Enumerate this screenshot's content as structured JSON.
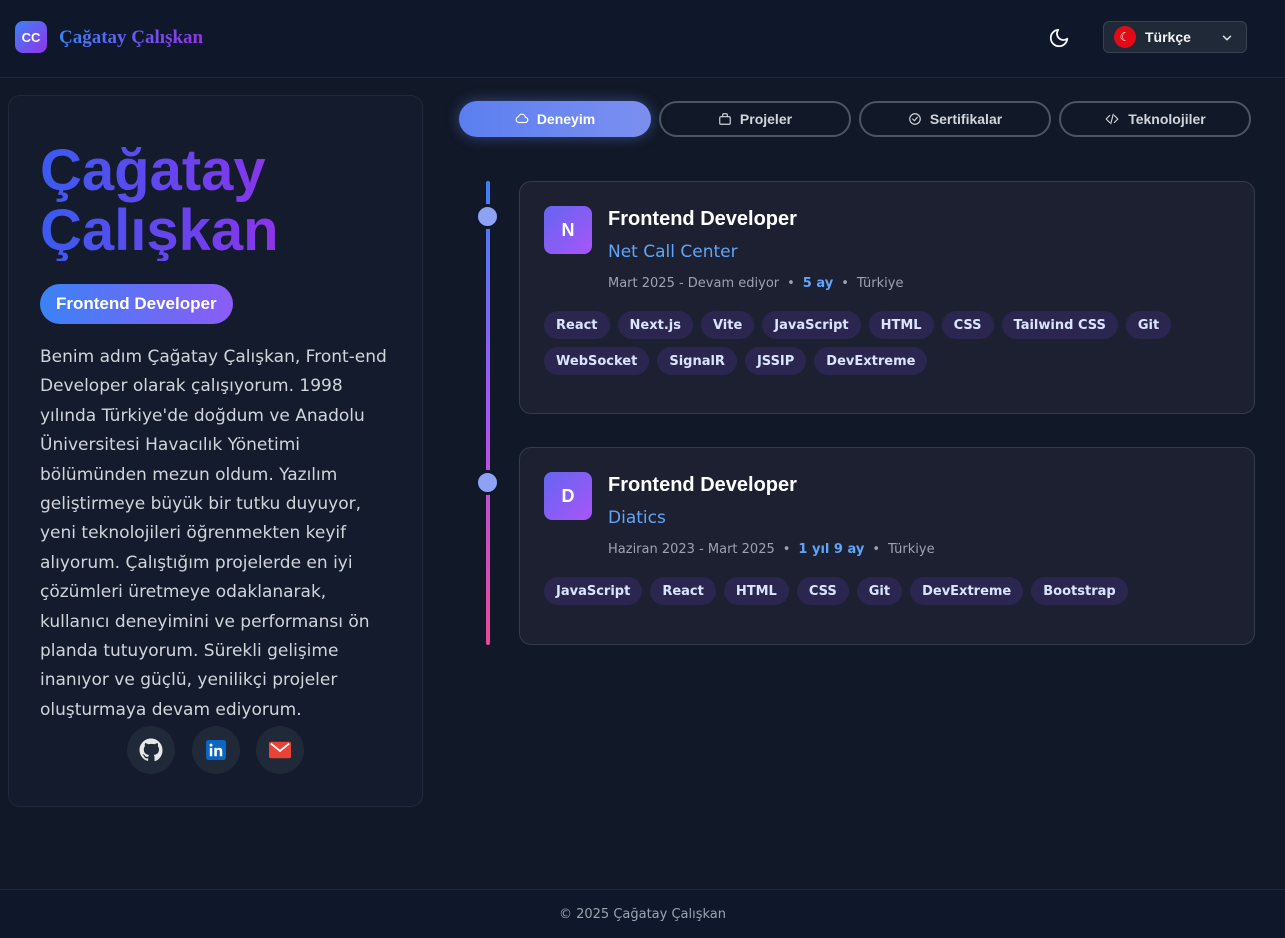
{
  "header": {
    "logo_initials": "CC",
    "site_name": "Çağatay Çalışkan",
    "language": {
      "flag": "☾",
      "label": "Türkçe"
    }
  },
  "profile": {
    "name_line1": "Çağatay",
    "name_line2": "Çalışkan",
    "role": "Frontend Developer",
    "bio": "Benim adım Çağatay Çalışkan, Front-end Developer olarak çalışıyorum. 1998 yılında Türkiye'de doğdum ve Anadolu Üniversitesi Havacılık Yönetimi bölümünden mezun oldum. Yazılım geliştirmeye büyük bir tutku duyuyor, yeni teknolojileri öğrenmekten keyif alıyorum. Çalıştığım projelerde en iyi çözümleri üretmeye odaklanarak, kullanıcı deneyimini ve performansı ön planda tutuyorum. Sürekli gelişime inanıyor ve güçlü, yenilikçi projeler oluşturmaya devam ediyorum.",
    "social": [
      {
        "icon": "github-icon"
      },
      {
        "icon": "linkedin-icon"
      },
      {
        "icon": "email-icon"
      }
    ]
  },
  "tabs": [
    {
      "label": "Deneyim",
      "icon": "briefcase-icon",
      "active": true
    },
    {
      "label": "Projeler",
      "icon": "folder-icon",
      "active": false
    },
    {
      "label": "Sertifikalar",
      "icon": "check-circle-icon",
      "active": false
    },
    {
      "label": "Teknolojiler",
      "icon": "code-icon",
      "active": false
    }
  ],
  "experience": [
    {
      "badge": "N",
      "title": "Frontend Developer",
      "company": "Net Call Center",
      "period": "Mart 2025 - Devam ediyor",
      "duration": "5 ay",
      "location": "Türkiye",
      "tags": [
        "React",
        "Next.js",
        "Vite",
        "JavaScript",
        "HTML",
        "CSS",
        "Tailwind CSS",
        "Git",
        "WebSocket",
        "SignalR",
        "JSSIP",
        "DevExtreme"
      ]
    },
    {
      "badge": "D",
      "title": "Frontend Developer",
      "company": "Diatics",
      "period": "Haziran 2023 - Mart 2025",
      "duration": "1 yıl 9 ay",
      "location": "Türkiye",
      "tags": [
        "JavaScript",
        "React",
        "HTML",
        "CSS",
        "Git",
        "DevExtreme",
        "Bootstrap"
      ]
    }
  ],
  "footer": {
    "copyright": "© 2025 Çağatay Çalışkan"
  },
  "colors": {
    "background": "#111827",
    "accent_blue": "#3b82f6",
    "accent_purple": "#9333ea",
    "tag_bg": "#2a2650"
  }
}
